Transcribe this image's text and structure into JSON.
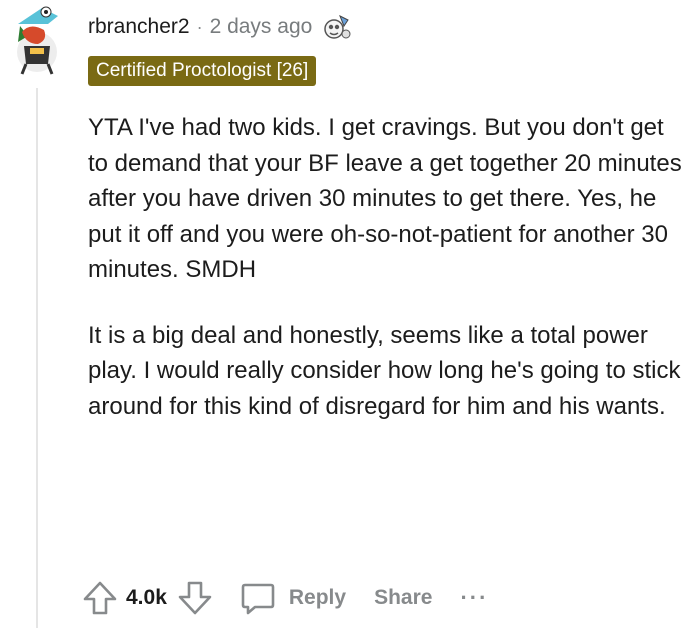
{
  "comment": {
    "username": "rbrancher2",
    "separator": "·",
    "timestamp": "2 days ago",
    "flair": "Certified Proctologist [26]",
    "paragraphs": [
      "YTA I've had two kids. I get cravings. But you don't get to demand that your BF leave a get together 20 minutes after you have driven 30 minutes to get there. Yes, he put it off and you were oh-so-not-patient for another 30 minutes. SMDH",
      "It is a big deal and honestly, seems like a total power play. I would really consider how long he's going to stick around for this kind of disregard for him and his wants."
    ]
  },
  "actions": {
    "vote_count": "4.0k",
    "reply_label": "Reply",
    "share_label": "Share",
    "more_label": "···"
  },
  "icons": {
    "upvote": "upvote-arrow-icon",
    "downvote": "downvote-arrow-icon",
    "reply": "speech-bubble-icon",
    "award": "award-badge-icon",
    "more": "ellipsis-icon"
  },
  "colors": {
    "flair_bg": "#7a6a14",
    "meta_gray": "#787c7e",
    "text": "#1c1c1c",
    "action_gray": "#878a8c"
  }
}
